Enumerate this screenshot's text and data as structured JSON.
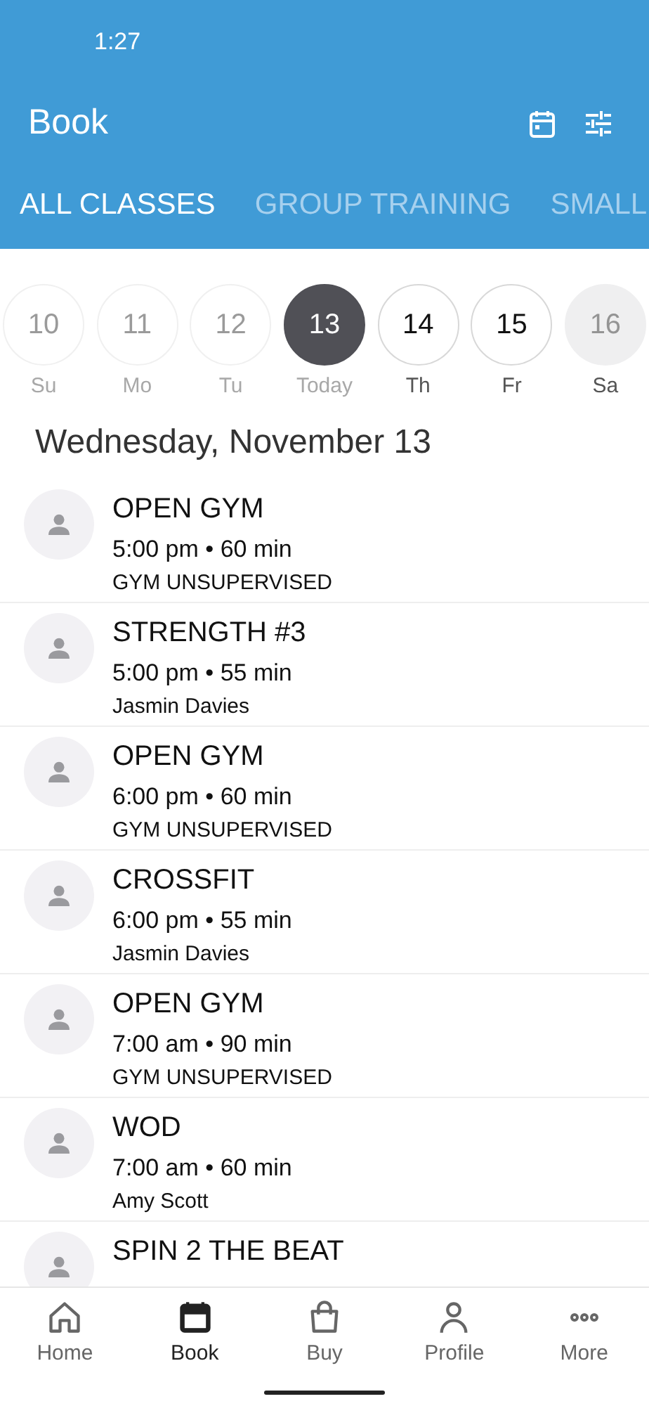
{
  "status_bar": {
    "time": "1:27"
  },
  "header": {
    "title": "Book"
  },
  "tabs": [
    {
      "label": "ALL CLASSES",
      "selected": true
    },
    {
      "label": "GROUP TRAINING",
      "selected": false
    },
    {
      "label": "SMALL",
      "selected": false
    }
  ],
  "dates": [
    {
      "day": "10",
      "weekday": "Su",
      "kind": "past",
      "selected": false
    },
    {
      "day": "11",
      "weekday": "Mo",
      "kind": "past",
      "selected": false
    },
    {
      "day": "12",
      "weekday": "Tu",
      "kind": "past",
      "selected": false
    },
    {
      "day": "13",
      "weekday": "Today",
      "kind": "past",
      "selected": true
    },
    {
      "day": "14",
      "weekday": "Th",
      "kind": "available",
      "selected": false
    },
    {
      "day": "15",
      "weekday": "Fr",
      "kind": "available",
      "selected": false
    },
    {
      "day": "16",
      "weekday": "Sa",
      "kind": "unavailable",
      "selected": false
    }
  ],
  "date_heading": "Wednesday, November 13",
  "classes": [
    {
      "name": "OPEN GYM",
      "time": "5:00 pm • 60 min",
      "instructor": "GYM UNSUPERVISED"
    },
    {
      "name": "STRENGTH #3",
      "time": "5:00 pm • 55 min",
      "instructor": "Jasmin Davies"
    },
    {
      "name": "OPEN GYM",
      "time": "6:00 pm • 60 min",
      "instructor": "GYM UNSUPERVISED"
    },
    {
      "name": "CROSSFIT",
      "time": "6:00 pm • 55 min",
      "instructor": "Jasmin Davies"
    },
    {
      "name": "OPEN GYM",
      "time": "7:00 am • 90 min",
      "instructor": "GYM UNSUPERVISED"
    },
    {
      "name": "WOD",
      "time": "7:00 am • 60 min",
      "instructor": "Amy Scott"
    },
    {
      "name": "SPIN 2 THE BEAT"
    }
  ],
  "bottom_nav": [
    {
      "label": "Home",
      "kind": "home",
      "selected": false
    },
    {
      "label": "Book",
      "kind": "book",
      "selected": true
    },
    {
      "label": "Buy",
      "kind": "buy",
      "selected": false
    },
    {
      "label": "Profile",
      "kind": "profile",
      "selected": false
    },
    {
      "label": "More",
      "kind": "more",
      "selected": false
    }
  ]
}
